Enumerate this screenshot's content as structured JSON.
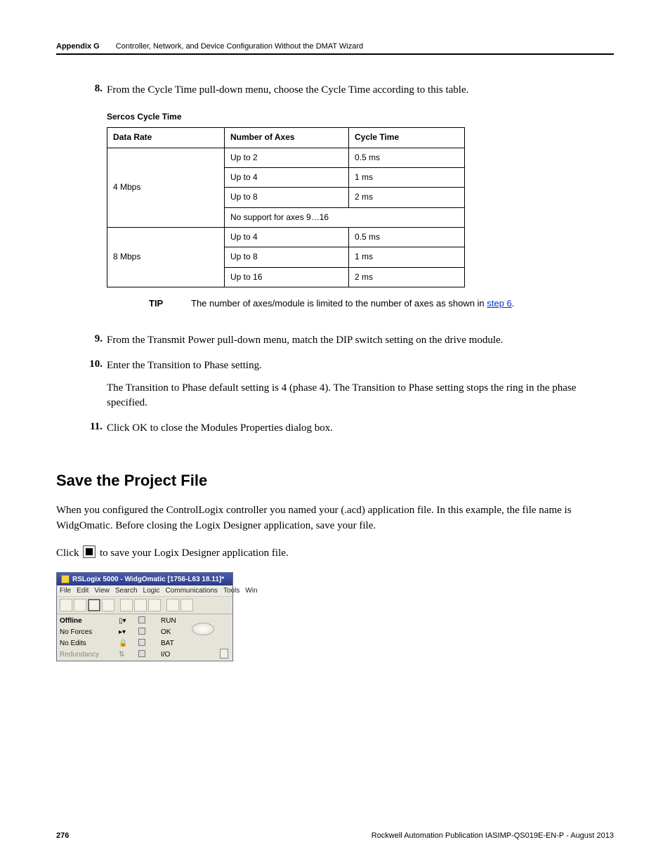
{
  "header": {
    "appendix": "Appendix G",
    "title": "Controller, Network, and Device Configuration Without the DMAT Wizard"
  },
  "step8": {
    "num": "8.",
    "text": "From the Cycle Time pull-down menu, choose the Cycle Time according to this table."
  },
  "table": {
    "caption": "Sercos Cycle Time",
    "headers": {
      "data_rate": "Data Rate",
      "num_axes": "Number of Axes",
      "cycle_time": "Cycle Time"
    },
    "rows": {
      "r1_rate": "4 Mbps",
      "r1a": "Up to 2",
      "r1a_ct": "0.5 ms",
      "r1b": "Up to 4",
      "r1b_ct": "1 ms",
      "r1c": "Up to 8",
      "r1c_ct": "2 ms",
      "r1d": "No support for axes 9…16",
      "r2_rate": "8 Mbps",
      "r2a": "Up to 4",
      "r2a_ct": "0.5 ms",
      "r2b": "Up to 8",
      "r2b_ct": "1 ms",
      "r2c": "Up to 16",
      "r2c_ct": "2 ms"
    }
  },
  "tip": {
    "label": "TIP",
    "text_before": "The number of axes/module is limited to the number of axes as shown in ",
    "link_text": "step 6",
    "text_after": "."
  },
  "step9": {
    "num": "9.",
    "text": "From the Transmit Power pull-down menu, match the DIP switch setting on the drive module."
  },
  "step10": {
    "num": "10.",
    "text1": "Enter the Transition to Phase setting.",
    "text2": "The Transition to Phase default setting is 4 (phase 4). The Transition to Phase setting stops the ring in the phase specified."
  },
  "step11": {
    "num": "11.",
    "text": "Click OK to close the Modules Properties dialog box."
  },
  "section": {
    "heading": "Save the Project File",
    "para1": "When you configured the ControlLogix controller you named your (.acd) application file. In this example, the file name is WidgOmatic. Before closing the Logix Designer application, save your file.",
    "para2_before": "Click ",
    "para2_after": " to save your Logix Designer application file."
  },
  "screenshot": {
    "title": "RSLogix 5000 - WidgOmatic [1756-L63 18.11]*",
    "menus": [
      "File",
      "Edit",
      "View",
      "Search",
      "Logic",
      "Communications",
      "Tools",
      "Win"
    ],
    "status": {
      "offline": "Offline",
      "no_forces": "No Forces",
      "no_edits": "No Edits",
      "redundancy": "Redundancy",
      "run": "RUN",
      "ok": "OK",
      "bat": "BAT",
      "io": "I/O"
    }
  },
  "footer": {
    "page": "276",
    "pub": "Rockwell Automation Publication IASIMP-QS019E-EN-P - August 2013"
  }
}
